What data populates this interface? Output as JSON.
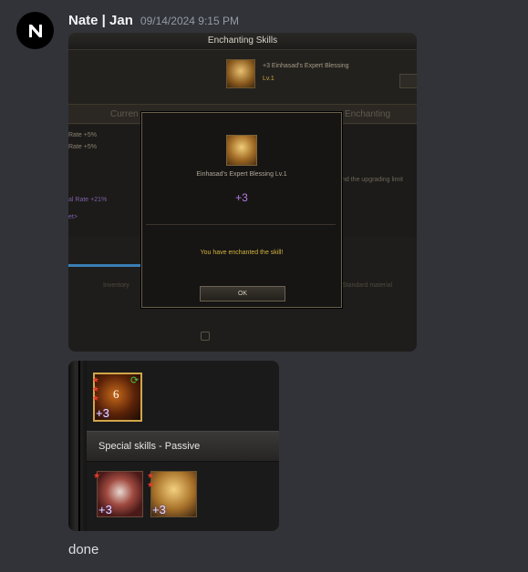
{
  "message": {
    "author": "Nate | Jan",
    "timestamp": "09/14/2024 9:15 PM",
    "text": "done"
  },
  "screenshot1": {
    "window_title": "Enchanting Skills",
    "skill_name_small": "+3 Einhasad's Expert Blessing",
    "skill_level_small": "Lv.1",
    "tab_current": "Curren",
    "tab_enchanting": "Enchanting",
    "left_lines": [
      "Rate +5%",
      "Rate +5%",
      "al Rate +21%",
      "et>"
    ],
    "right_text": "nd the upgrading limit",
    "inventory_label": "Inventory",
    "material_label": "Standard material",
    "modal": {
      "skill_name": "Einhasad's Expert Blessing Lv.1",
      "level": "+3",
      "message": "You have enchanted the skill!",
      "ok_label": "OK"
    }
  },
  "screenshot2": {
    "big_skill_level": "6",
    "big_skill_plus": "+3",
    "section_label": "Special skills - Passive",
    "passive1_plus": "+3",
    "passive2_plus": "+3"
  },
  "icons": {
    "avatar": "logo-icon",
    "star": "star-icon",
    "refresh": "refresh-icon"
  },
  "colors": {
    "background": "#313338",
    "modal_level": "#b67ae0",
    "modal_message": "#d4b23c",
    "star": "#e53a2a"
  }
}
